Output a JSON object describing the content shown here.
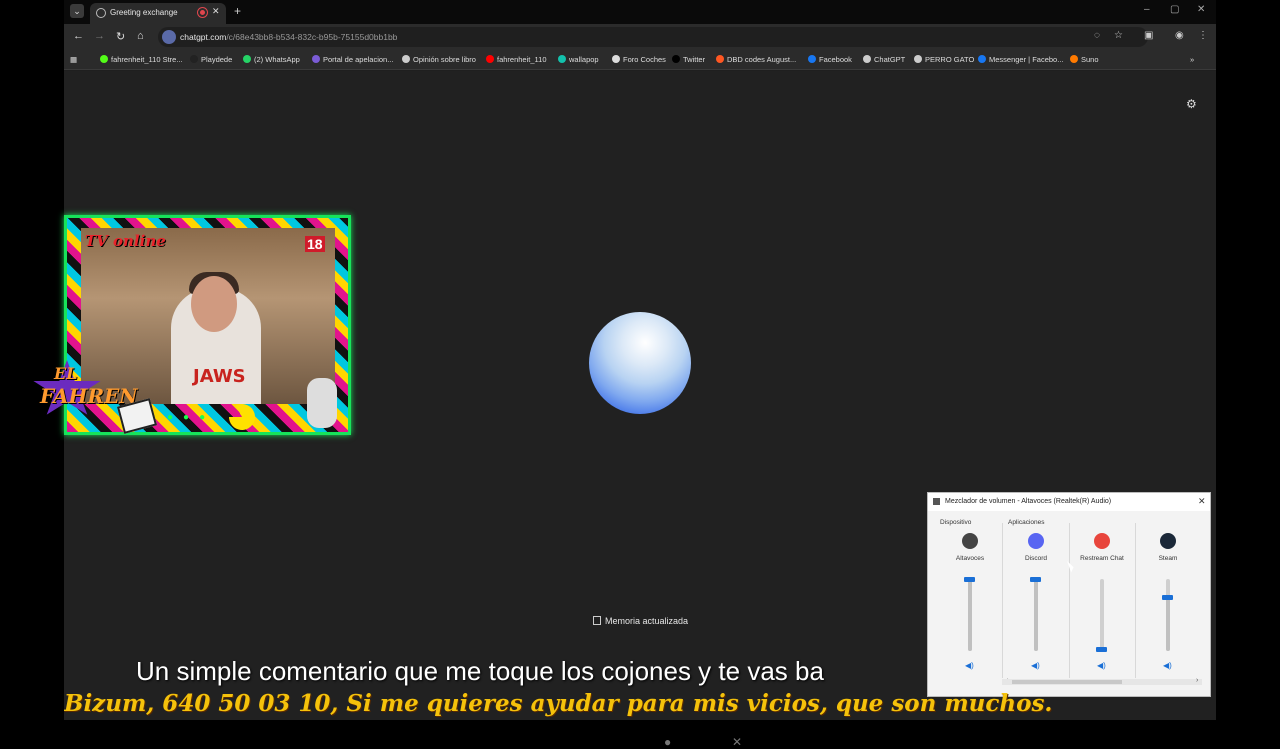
{
  "browser": {
    "tab_title": "Greeting exchange",
    "tab_close": "✕",
    "new_tab": "+",
    "window_controls": {
      "minimize": "–",
      "maximize": "▢",
      "close": "✕"
    },
    "url_host": "chatgpt.com",
    "url_path": "/c/68e43bb8-b534-832c-b95b-75155d0bb1bb",
    "nav": {
      "back": "←",
      "forward": "→",
      "reload": "↻",
      "home": "⌂"
    },
    "toolbar_icons": [
      "eye-off-icon",
      "star-icon",
      "extensions-icon",
      "profile-icon",
      "more-icon"
    ]
  },
  "bookmarks": [
    {
      "label": "fahrenheit_110 Stre...",
      "color": "#53fc18"
    },
    {
      "label": "Playdede",
      "color": "#222222"
    },
    {
      "label": "(2) WhatsApp",
      "color": "#25d366"
    },
    {
      "label": "Portal de apelacion...",
      "color": "#7b5cd6"
    },
    {
      "label": "Opinión sobre libro",
      "color": "#cccccc"
    },
    {
      "label": "fahrenheit_110",
      "color": "#ff0000"
    },
    {
      "label": "wallapop",
      "color": "#13c1ac"
    },
    {
      "label": "Foro Coches",
      "color": "#dddddd"
    },
    {
      "label": "Twitter",
      "color": "#000000"
    },
    {
      "label": "DBD codes August...",
      "color": "#ff5722"
    },
    {
      "label": "Facebook",
      "color": "#1877f2"
    },
    {
      "label": "ChatGPT",
      "color": "#cccccc"
    },
    {
      "label": "PERRO GATO",
      "color": "#cccccc"
    },
    {
      "label": "Messenger | Facebo...",
      "color": "#1877f2"
    },
    {
      "label": "Suno",
      "color": "#ff7a00"
    }
  ],
  "chat": {
    "memory_text": "Memoria actualizada",
    "settings_icon": "sliders-icon"
  },
  "overlay": {
    "tv_online": "TV online",
    "age": "18",
    "shirt_text": "JAWS",
    "logo_top": "EL",
    "logo_bottom": "FAHREN"
  },
  "mixer": {
    "title": "Mezclador de volumen - Altavoces (Realtek(R) Audio)",
    "device_header": "Dispositivo",
    "apps_header": "Aplicaciones",
    "channels": [
      {
        "label": "Altavoces",
        "level": 1.0,
        "color": "#444444"
      },
      {
        "label": "Discord",
        "level": 1.0,
        "color": "#5865f2"
      },
      {
        "label": "Restream Chat",
        "level": 0.03,
        "color": "#e8453c"
      },
      {
        "label": "Steam",
        "level": 0.75,
        "color": "#1b2838"
      }
    ]
  },
  "captions": {
    "subtitle": "Un simple comentario que me toque los cojones y te vas ba",
    "ticker": "Bizum, 640 50 03 10,  Si me quieres ayudar para mis vicios, que son muchos."
  }
}
